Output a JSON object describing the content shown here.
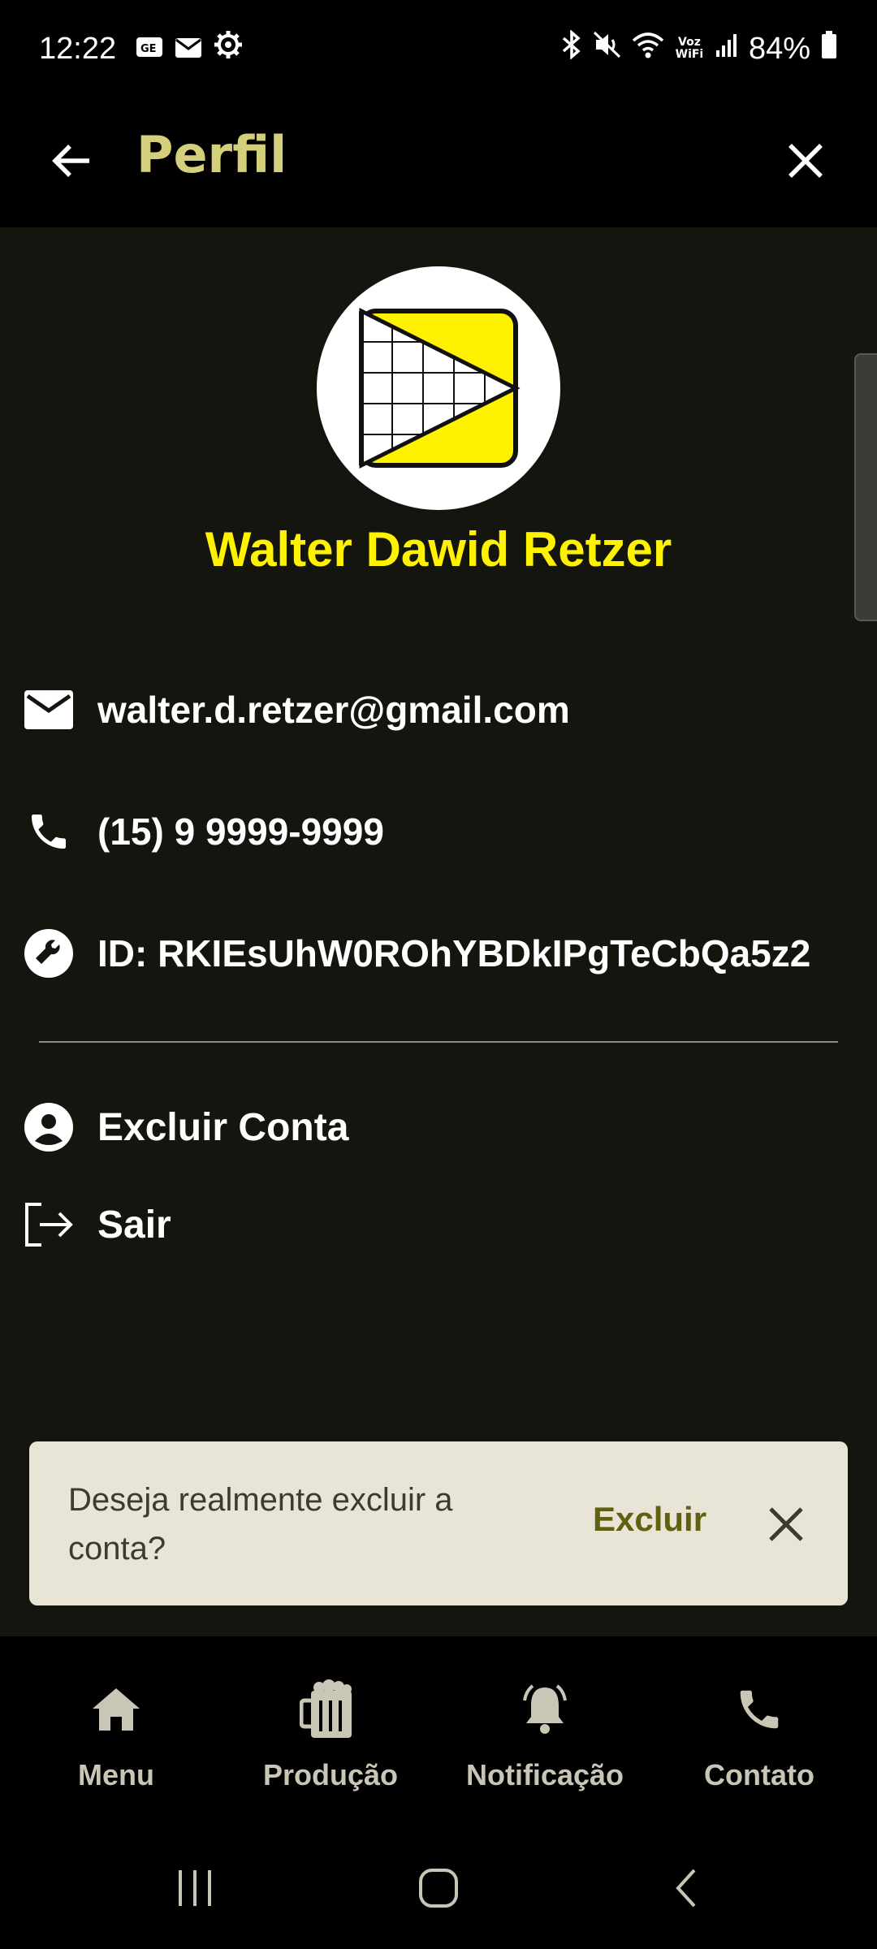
{
  "status_bar": {
    "time": "12:22",
    "battery": "84%",
    "left_icons": [
      "sim-card-icon",
      "mail-icon",
      "settings-gear-icon"
    ],
    "right_icons": [
      "bluetooth-icon",
      "mute-icon",
      "wifi-icon",
      "voz-wifi-icon",
      "signal-icon",
      "battery-icon"
    ],
    "voz_wifi_label": "Voz WiFi"
  },
  "app_bar": {
    "title": "Perfil",
    "title_color": "#d4cf7a"
  },
  "profile": {
    "name": "Walter Dawid Retzer",
    "name_color": "#fff200",
    "email": "walter.d.retzer@gmail.com",
    "phone": "(15) 9 9999-9999",
    "id": "ID: RKIEsUhW0ROhYBDkIPgTeCbQa5z2"
  },
  "actions": {
    "delete_account": "Excluir Conta",
    "logout": "Sair"
  },
  "snackbar": {
    "message": "Deseja realmente excluir a conta?",
    "action": "Excluir"
  },
  "bottom_nav": [
    {
      "label": "Menu",
      "icon": "home-icon"
    },
    {
      "label": "Produção",
      "icon": "beer-mug-icon"
    },
    {
      "label": "Notificação",
      "icon": "bell-icon"
    },
    {
      "label": "Contato",
      "icon": "phone-icon"
    }
  ]
}
